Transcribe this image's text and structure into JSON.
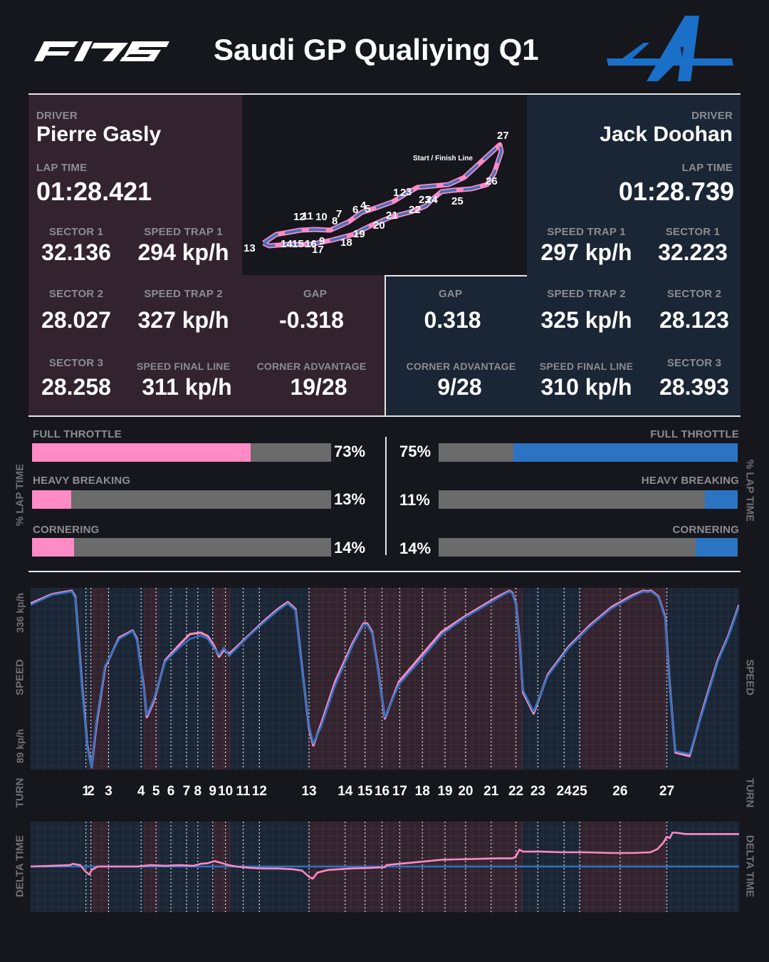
{
  "header": {
    "title": "Saudi GP Qualiying Q1",
    "f1_logo_text": "F1 75",
    "team_logo": "alpine-logo"
  },
  "colors": {
    "background": "#16161d",
    "driver1": "#ff8ac4",
    "driver2": "#2b74c4",
    "panel1": "#33232f",
    "panel2": "#1a2535",
    "bar_bg": "#6b6b6b"
  },
  "driver1": {
    "driver_label": "DRIVER",
    "name": "Pierre Gasly",
    "lap_time_label": "LAP TIME",
    "lap_time": "01:28.421",
    "sector1_label": "SECTOR 1",
    "sector1": "32.136",
    "trap1_label": "SPEED TRAP 1",
    "trap1": "294 kp/h",
    "sector2_label": "SECTOR 2",
    "sector2": "28.027",
    "trap2_label": "SPEED TRAP 2",
    "trap2": "327 kp/h",
    "gap_label": "GAP",
    "gap": "-0.318",
    "sector3_label": "SECTOR 3",
    "sector3": "28.258",
    "final_label": "SPEED FINAL LINE",
    "final": "311 kp/h",
    "corner_label": "CORNER ADVANTAGE",
    "corner": "19/28"
  },
  "driver2": {
    "driver_label": "DRIVER",
    "name": "Jack Doohan",
    "lap_time_label": "LAP TIME",
    "lap_time": "01:28.739",
    "sector1_label": "SECTOR 1",
    "sector1": "32.223",
    "trap1_label": "SPEED TRAP 1",
    "trap1": "297 kp/h",
    "sector2_label": "SECTOR 2",
    "sector2": "28.123",
    "trap2_label": "SPEED TRAP 2",
    "trap2": "325 kp/h",
    "gap_label": "GAP",
    "gap": "0.318",
    "sector3_label": "SECTOR 3",
    "sector3": "28.393",
    "final_label": "SPEED FINAL LINE",
    "final": "310 kp/h",
    "corner_label": "CORNER ADVANTAGE",
    "corner": "9/28"
  },
  "track_map": {
    "start_finish_label": "Start / Finish Line",
    "turn_labels": [
      "1",
      "2",
      "3",
      "4",
      "5",
      "6",
      "7",
      "8",
      "9",
      "10",
      "11",
      "12",
      "13",
      "14",
      "15",
      "16",
      "17",
      "18",
      "19",
      "20",
      "21",
      "22",
      "23",
      "24",
      "25",
      "26",
      "27"
    ]
  },
  "throttle": {
    "side_label": "% LAP TIME",
    "full_label": "FULL THROTTLE",
    "heavy_label": "HEAVY BREAKING",
    "corner_label": "CORNERING",
    "d1": {
      "full": 73,
      "full_text": "73%",
      "heavy": 13,
      "heavy_text": "13%",
      "corner": 14,
      "corner_text": "14%"
    },
    "d2": {
      "full": 75,
      "full_text": "75%",
      "heavy": 11,
      "heavy_text": "11%",
      "corner": 14,
      "corner_text": "14%"
    }
  },
  "axes": {
    "speed_label": "SPEED",
    "speed_top": "336 kp/h",
    "speed_bottom": "89 kp/h",
    "turn_label": "TURN",
    "delta_label": "DELTA TIME"
  },
  "chart_data": [
    {
      "type": "line",
      "title": "",
      "ylabel": "SPEED",
      "ylim": [
        89,
        336
      ],
      "x_domain": [
        0,
        100
      ],
      "corner_advantage_shading": {
        "driver1_ranges": [
          [
            8.5,
            11
          ],
          [
            16,
            18
          ],
          [
            25.7,
            28.2
          ],
          [
            39.3,
            69.5
          ],
          [
            77.5,
            89.8
          ]
        ],
        "driver2_ranges": [
          [
            0,
            8.5
          ],
          [
            11,
            16
          ],
          [
            18,
            25.7
          ],
          [
            28.2,
            39.3
          ],
          [
            69.5,
            77.5
          ],
          [
            89.8,
            100
          ]
        ]
      },
      "turn_positions": [
        7.8,
        8.5,
        11,
        15.6,
        17.7,
        19.8,
        22,
        23.6,
        25.7,
        27.5,
        30,
        32.3,
        39.3,
        44.4,
        47.2,
        49.6,
        52.1,
        55.3,
        58.5,
        61.4,
        65,
        68.5,
        71.6,
        75.3,
        77.5,
        83.2,
        89.8
      ],
      "turn_labels": [
        "1",
        "2",
        "3",
        "4",
        "5",
        "6",
        "7",
        "8",
        "9",
        "10",
        "11",
        "12",
        "13",
        "14",
        "15",
        "16",
        "17",
        "18",
        "19",
        "20",
        "21",
        "22",
        "23",
        "24",
        "25",
        "26",
        "27"
      ],
      "series": [
        {
          "name": "Pierre Gasly",
          "x": [
            0,
            3,
            5.8,
            6.3,
            7.3,
            8,
            8.6,
            9.3,
            10.5,
            12.5,
            14.4,
            15,
            16,
            16.4,
            17.3,
            19,
            21,
            22.5,
            24,
            25,
            25.8,
            26.6,
            27.3,
            28,
            29,
            31,
            33,
            35,
            36.3,
            37.4,
            38.3,
            39.3,
            39.9,
            41,
            43,
            45.5,
            47,
            47.5,
            48.2,
            49,
            50,
            52,
            55,
            58,
            61,
            64,
            66,
            67.6,
            68,
            68.5,
            69,
            69.5,
            71,
            73,
            76,
            79,
            82,
            85,
            86.5,
            87,
            87.6,
            88.6,
            89.6,
            90.2,
            91,
            93,
            95,
            97,
            98.5,
            100
          ],
          "y": [
            320,
            333,
            338,
            330,
            200,
            120,
            89,
            150,
            230,
            272,
            282,
            270,
            200,
            160,
            180,
            240,
            262,
            277,
            279,
            274,
            262,
            245,
            255,
            249,
            258,
            277,
            296,
            313,
            322,
            312,
            230,
            145,
            120,
            150,
            210,
            265,
            292,
            292,
            280,
            230,
            158,
            210,
            245,
            280,
            300,
            318,
            330,
            338,
            335,
            320,
            270,
            195,
            165,
            220,
            260,
            290,
            315,
            332,
            338,
            337,
            338,
            330,
            300,
            205,
            110,
            105,
            175,
            240,
            275,
            318
          ]
        },
        {
          "name": "Jack Doohan",
          "x": [
            0,
            3,
            5.8,
            6.3,
            7.3,
            8,
            8.6,
            9.3,
            10.5,
            12.5,
            14.4,
            15,
            16,
            16.4,
            17.3,
            19,
            21,
            22.5,
            24,
            25,
            25.8,
            26.6,
            27.3,
            28,
            29,
            31,
            33,
            35,
            36.3,
            37.4,
            38.3,
            39.3,
            39.9,
            41,
            43,
            45.5,
            47,
            47.5,
            48.2,
            49,
            50,
            52,
            55,
            58,
            61,
            64,
            66,
            67.6,
            68,
            68.5,
            69,
            69.5,
            71,
            73,
            76,
            79,
            82,
            85,
            86.5,
            87,
            87.6,
            88.6,
            89.6,
            90.2,
            91,
            93,
            95,
            97,
            98.5,
            100
          ],
          "y": [
            318,
            332,
            337,
            328,
            195,
            118,
            89,
            155,
            232,
            270,
            281,
            268,
            198,
            163,
            183,
            238,
            258,
            270,
            275,
            270,
            258,
            248,
            258,
            246,
            256,
            276,
            294,
            311,
            320,
            310,
            228,
            148,
            123,
            146,
            205,
            262,
            290,
            290,
            278,
            228,
            160,
            206,
            240,
            276,
            298,
            316,
            328,
            337,
            334,
            318,
            268,
            198,
            168,
            218,
            258,
            288,
            313,
            330,
            337,
            336,
            337,
            329,
            298,
            202,
            112,
            108,
            172,
            238,
            273,
            316
          ]
        }
      ]
    },
    {
      "type": "line",
      "title": "",
      "ylabel": "DELTA TIME",
      "x_domain": [
        0,
        100
      ],
      "reference_series": "Jack Doohan",
      "reference_value": 0,
      "series": [
        {
          "name": "Pierre Gasly",
          "x": [
            0,
            3,
            5.5,
            6,
            7,
            7.8,
            8.3,
            8.6,
            9.5,
            11,
            13,
            15,
            17,
            19,
            21,
            23,
            24,
            25,
            26,
            27,
            28,
            29,
            31,
            33,
            35,
            37,
            38.3,
            39.3,
            39.8,
            40.5,
            42,
            45,
            48,
            50,
            50.2,
            52,
            55,
            58,
            62,
            66,
            68,
            68.5,
            69,
            69.5,
            72,
            75,
            78,
            82,
            85,
            87.5,
            88.5,
            89.3,
            89.8,
            90.2,
            90.6,
            91,
            92.5,
            95,
            98,
            100
          ],
          "y": [
            0.0,
            0.01,
            0.02,
            0.04,
            0.02,
            -0.08,
            -0.12,
            -0.05,
            0.0,
            0.0,
            0.0,
            0.0,
            0.02,
            0.01,
            0.02,
            0.01,
            0.04,
            0.05,
            0.08,
            0.05,
            0.02,
            0.0,
            -0.02,
            -0.03,
            -0.03,
            -0.04,
            -0.06,
            -0.15,
            -0.18,
            -0.09,
            -0.05,
            -0.03,
            -0.02,
            -0.01,
            0.02,
            0.04,
            0.07,
            0.1,
            0.11,
            0.12,
            0.12,
            0.15,
            0.25,
            0.22,
            0.22,
            0.21,
            0.21,
            0.2,
            0.2,
            0.21,
            0.26,
            0.35,
            0.44,
            0.42,
            0.5,
            0.5,
            0.48,
            0.48,
            0.48,
            0.48
          ]
        },
        {
          "name": "Jack Doohan",
          "x": [
            0,
            100
          ],
          "y": [
            0,
            0
          ]
        }
      ]
    }
  ]
}
